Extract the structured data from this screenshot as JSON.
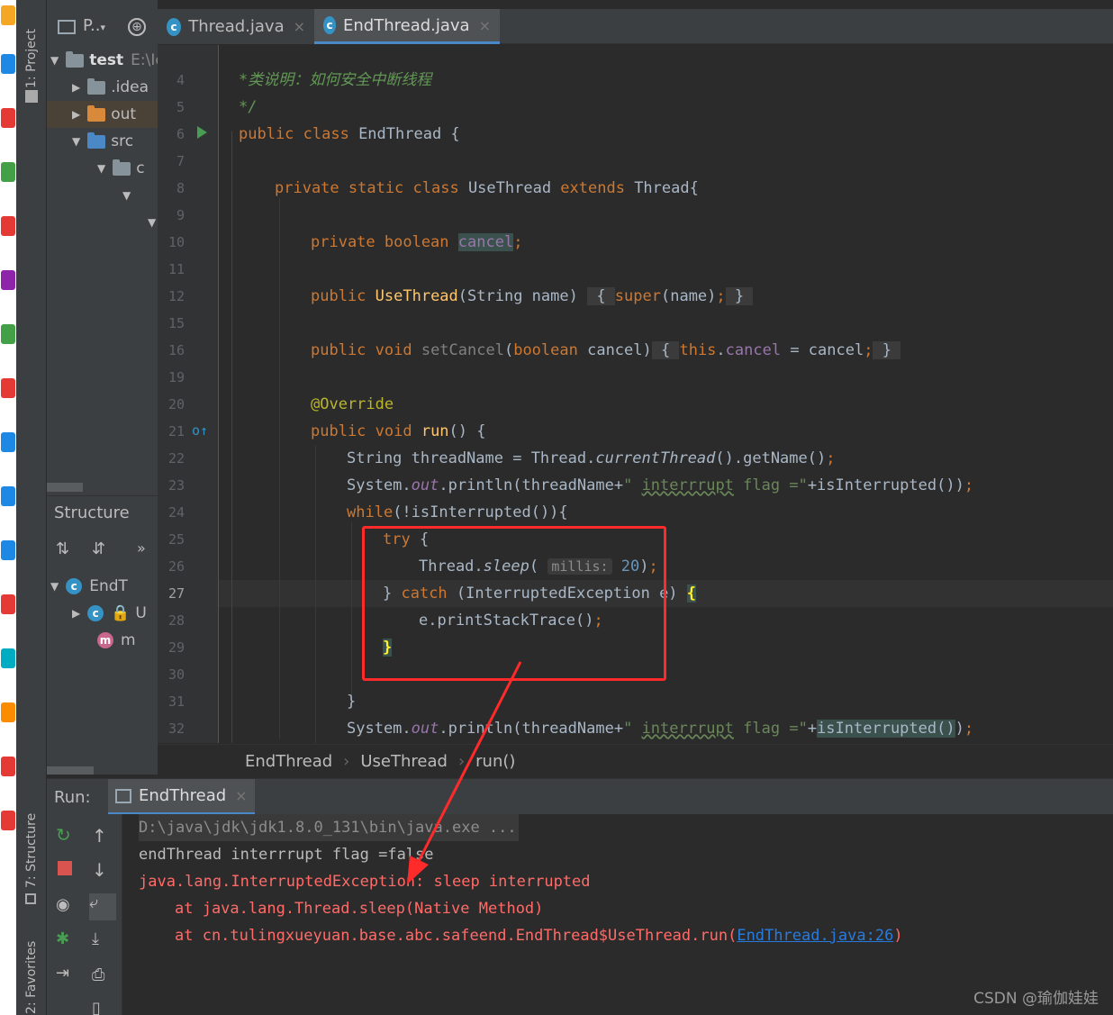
{
  "tool_strip": {
    "project_tab": "1: Project",
    "structure_tab": "7: Structure",
    "favorites_tab": "2: Favorites"
  },
  "project": {
    "header_label": "P..",
    "tree": [
      {
        "label": "test",
        "path": "E:\\IdeaLearnWorkspace\\test"
      },
      {
        "label": ".idea"
      },
      {
        "label": "out"
      },
      {
        "label": "src"
      },
      {
        "label": "c"
      }
    ]
  },
  "structure": {
    "title": "Structure",
    "more": "»",
    "items": [
      {
        "label": "EndT"
      },
      {
        "label": "U"
      },
      {
        "label": "m"
      }
    ]
  },
  "tabs": [
    {
      "label": "Thread.java",
      "active": false
    },
    {
      "label": "EndThread.java",
      "active": true
    }
  ],
  "editor": {
    "lines": [
      {
        "num": "4",
        "text": "*类说明：如何安全中断线程"
      },
      {
        "num": "5",
        "text": "*/"
      },
      {
        "num": "6",
        "text": "public class EndThread {"
      },
      {
        "num": "7",
        "text": ""
      },
      {
        "num": "8",
        "text": "private static class UseThread extends Thread{"
      },
      {
        "num": "9",
        "text": ""
      },
      {
        "num": "10",
        "text": "private boolean cancel;"
      },
      {
        "num": "11",
        "text": ""
      },
      {
        "num": "12",
        "text": "public UseThread(String name) { super(name); }"
      },
      {
        "num": "15",
        "text": ""
      },
      {
        "num": "16",
        "text": "public void setCancel(boolean cancel) { this.cancel = cancel; }"
      },
      {
        "num": "19",
        "text": ""
      },
      {
        "num": "20",
        "text": "@Override"
      },
      {
        "num": "21",
        "text": "public void run() {"
      },
      {
        "num": "22",
        "text": "String threadName = Thread.currentThread().getName();"
      },
      {
        "num": "23",
        "text": "System.out.println(threadName+\" interrrupt flag =\"+isInterrupted());"
      },
      {
        "num": "24",
        "text": "while(!isInterrupted()){"
      },
      {
        "num": "25",
        "text": "try {"
      },
      {
        "num": "26",
        "text": "Thread.sleep( millis: 20);"
      },
      {
        "num": "27",
        "text": "} catch (InterruptedException e) {"
      },
      {
        "num": "28",
        "text": "e.printStackTrace();"
      },
      {
        "num": "29",
        "text": "}"
      },
      {
        "num": "30",
        "text": ""
      },
      {
        "num": "31",
        "text": "}"
      },
      {
        "num": "32",
        "text": "System.out.println(threadName+\" interrrupt flag =\"+isInterrupted());"
      }
    ],
    "hint_label": "millis:"
  },
  "breadcrumb": [
    "EndThread",
    "UseThread",
    "run()"
  ],
  "run": {
    "label": "Run:",
    "tab": "EndThread",
    "console": [
      "D:\\java\\jdk\\jdk1.8.0_131\\bin\\java.exe ...",
      "endThread interrrupt flag =false",
      "java.lang.InterruptedException: sleep interrupted",
      "at java.lang.Thread.sleep(Native Method)",
      "at cn.tulingxueyuan.base.abc.safeend.EndThread$UseThread.run(",
      "EndThread.java:26",
      ")"
    ]
  },
  "watermark": "CSDN @瑜伽娃娃",
  "colors": {
    "keyword": "#cc7832",
    "annotation": "#bbb529",
    "field": "#9876aa",
    "string": "#6a8759",
    "number": "#6897bb",
    "error": "#ff6b68",
    "highlight_box": "#ff2b2b"
  }
}
